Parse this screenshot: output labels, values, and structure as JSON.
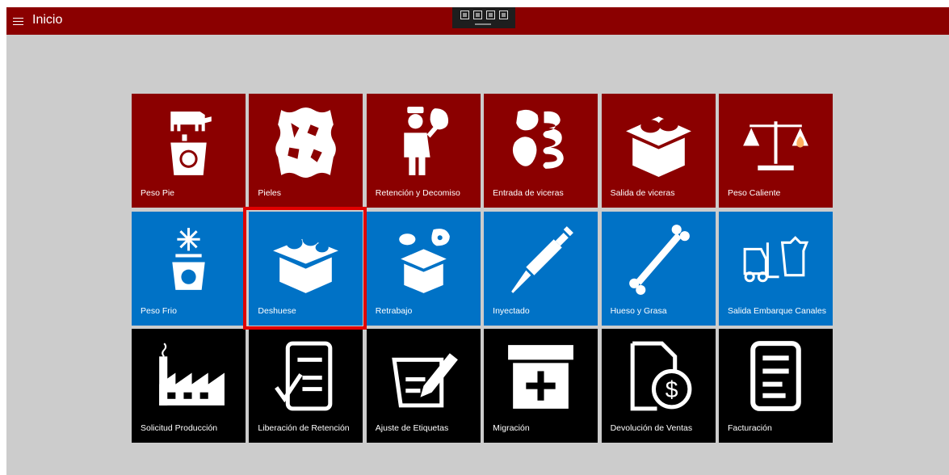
{
  "app": {
    "title": "Inicio"
  },
  "devtools": {
    "icons": [
      "live-visual-tree-icon",
      "select-element-icon",
      "display-layout-adorners-icon",
      "track-focus-icon"
    ]
  },
  "colors": {
    "red_tile": "#8b0000",
    "blue_tile": "#0072c6",
    "black_tile": "#000000",
    "selection": "#e00000"
  },
  "tiles": [
    {
      "label": "Peso Pie",
      "color": "red",
      "icon": "cow-scale-icon"
    },
    {
      "label": "Pieles",
      "color": "red",
      "icon": "hide-icon"
    },
    {
      "label": "Retención y Decomiso",
      "color": "red",
      "icon": "inspector-icon"
    },
    {
      "label": "Entrada de viceras",
      "color": "red",
      "icon": "organs-icon"
    },
    {
      "label": "Salida de viceras",
      "color": "red",
      "icon": "box-meat-icon"
    },
    {
      "label": "Peso Caliente",
      "color": "red",
      "icon": "balance-fire-icon"
    },
    {
      "label": "Peso Frio",
      "color": "blue",
      "icon": "snow-scale-icon"
    },
    {
      "label": "Deshuese",
      "color": "blue",
      "icon": "box-meat-icon",
      "selected": true
    },
    {
      "label": "Retrabajo",
      "color": "blue",
      "icon": "box-meat-extra-icon"
    },
    {
      "label": "Inyectado",
      "color": "blue",
      "icon": "syringe-icon"
    },
    {
      "label": "Hueso y Grasa",
      "color": "blue",
      "icon": "bone-icon"
    },
    {
      "label": "Salida Embarque Canales",
      "color": "blue",
      "icon": "forklift-cow-icon"
    },
    {
      "label": "Solicitud Producción",
      "color": "black",
      "icon": "factory-icon"
    },
    {
      "label": "Liberación de Retención",
      "color": "black",
      "icon": "document-check-icon"
    },
    {
      "label": "Ajuste de Etiquetas",
      "color": "black",
      "icon": "edit-document-icon"
    },
    {
      "label": "Migración",
      "color": "black",
      "icon": "box-plus-icon"
    },
    {
      "label": "Devolución de Ventas",
      "color": "black",
      "icon": "refund-icon"
    },
    {
      "label": "Facturación",
      "color": "black",
      "icon": "invoice-icon"
    }
  ]
}
